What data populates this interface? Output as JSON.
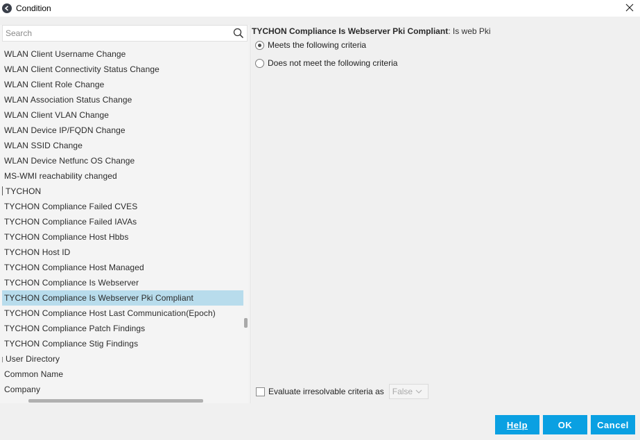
{
  "window": {
    "title": "Condition"
  },
  "search": {
    "placeholder": "Search",
    "value": ""
  },
  "list": {
    "items": [
      {
        "label": "WLAN Client Username Change"
      },
      {
        "label": "WLAN Client Connectivity Status Change"
      },
      {
        "label": "WLAN Client Role Change"
      },
      {
        "label": "WLAN Association Status Change"
      },
      {
        "label": "WLAN Client VLAN Change"
      },
      {
        "label": "WLAN Device IP/FQDN Change"
      },
      {
        "label": "WLAN SSID Change"
      },
      {
        "label": "WLAN Device Netfunc OS Change"
      },
      {
        "label": "MS-WMI reachability changed"
      },
      {
        "label": "TYCHON"
      },
      {
        "label": "TYCHON Compliance Failed CVES"
      },
      {
        "label": "TYCHON Compliance Failed IAVAs"
      },
      {
        "label": "TYCHON Compliance Host Hbbs"
      },
      {
        "label": "TYCHON Host ID"
      },
      {
        "label": "TYCHON Compliance Host Managed"
      },
      {
        "label": "TYCHON Compliance Is Webserver"
      },
      {
        "label": "TYCHON Compliance Is Webserver Pki Compliant"
      },
      {
        "label": "TYCHON Compliance Host Last Communication(Epoch)"
      },
      {
        "label": "TYCHON Compliance Patch Findings"
      },
      {
        "label": "TYCHON Compliance Stig Findings"
      },
      {
        "label": "User Directory"
      },
      {
        "label": "Common Name"
      },
      {
        "label": "Company"
      }
    ]
  },
  "condition": {
    "name": "TYCHON Compliance Is Webserver Pki Compliant",
    "separator": ":",
    "description": " Is web Pki",
    "options": [
      {
        "label": "Meets the following criteria",
        "selected": true
      },
      {
        "label": "Does not meet the following criteria",
        "selected": false
      }
    ]
  },
  "evaluate": {
    "label": "Evaluate irresolvable criteria as",
    "checked": false,
    "value": "False"
  },
  "buttons": {
    "help": "Help",
    "ok": "OK",
    "cancel": "Cancel"
  },
  "colors": {
    "accent": "#0aa0e2",
    "selection": "#b8dcec"
  },
  "icons": {
    "app": "app-logo-icon",
    "close": "close-icon",
    "search": "search-icon",
    "chevron": "chevron-down-icon"
  }
}
